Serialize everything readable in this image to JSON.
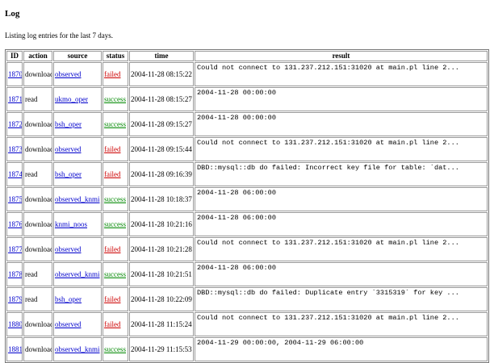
{
  "page": {
    "heading": "Log",
    "intro": "Listing log entries for the last 7 days."
  },
  "table": {
    "headers": [
      "ID",
      "action",
      "source",
      "status",
      "time",
      "result"
    ],
    "rows": [
      {
        "id": "1870",
        "action": "download",
        "source": "observed",
        "status": "failed",
        "time": "2004-11-28 08:15:22",
        "result": "Could not connect to 131.237.212.151:31020 at main.pl line 2..."
      },
      {
        "id": "1871",
        "action": "read",
        "source": "ukmo_oper",
        "status": "success",
        "time": "2004-11-28 08:15:27",
        "result": "2004-11-28 00:00:00"
      },
      {
        "id": "1872",
        "action": "download",
        "source": "bsh_oper",
        "status": "success",
        "time": "2004-11-28 09:15:27",
        "result": "2004-11-28 00:00:00"
      },
      {
        "id": "1873",
        "action": "download",
        "source": "observed",
        "status": "failed",
        "time": "2004-11-28 09:15:44",
        "result": "Could not connect to 131.237.212.151:31020 at main.pl line 2..."
      },
      {
        "id": "1874",
        "action": "read",
        "source": "bsh_oper",
        "status": "failed",
        "time": "2004-11-28 09:16:39",
        "result": "DBD::mysql::db do failed: Incorrect key file for table: `dat..."
      },
      {
        "id": "1875",
        "action": "download",
        "source": "observed_knmi",
        "status": "success",
        "time": "2004-11-28 10:18:37",
        "result": "2004-11-28 06:00:00"
      },
      {
        "id": "1876",
        "action": "download",
        "source": "knmi_noos",
        "status": "success",
        "time": "2004-11-28 10:21:16",
        "result": "2004-11-28 06:00:00"
      },
      {
        "id": "1877",
        "action": "download",
        "source": "observed",
        "status": "failed",
        "time": "2004-11-28 10:21:28",
        "result": "Could not connect to 131.237.212.151:31020 at main.pl line 2..."
      },
      {
        "id": "1878",
        "action": "read",
        "source": "observed_knmi",
        "status": "success",
        "time": "2004-11-28 10:21:51",
        "result": "2004-11-28 06:00:00"
      },
      {
        "id": "1879",
        "action": "read",
        "source": "bsh_oper",
        "status": "failed",
        "time": "2004-11-28 10:22:09",
        "result": "DBD::mysql::db do failed: Duplicate entry `3315319` for key ..."
      },
      {
        "id": "1880",
        "action": "download",
        "source": "observed",
        "status": "failed",
        "time": "2004-11-28 11:15:24",
        "result": "Could not connect to 131.237.212.151:31020 at main.pl line 2..."
      },
      {
        "id": "1881",
        "action": "download",
        "source": "observed_knmi",
        "status": "success",
        "time": "2004-11-29 11:15:53",
        "result": "2004-11-29 00:00:00, 2004-11-29 06:00:00"
      }
    ]
  },
  "colors": {
    "link": "#0000cc",
    "failed": "#cc0000",
    "success": "#008800"
  }
}
